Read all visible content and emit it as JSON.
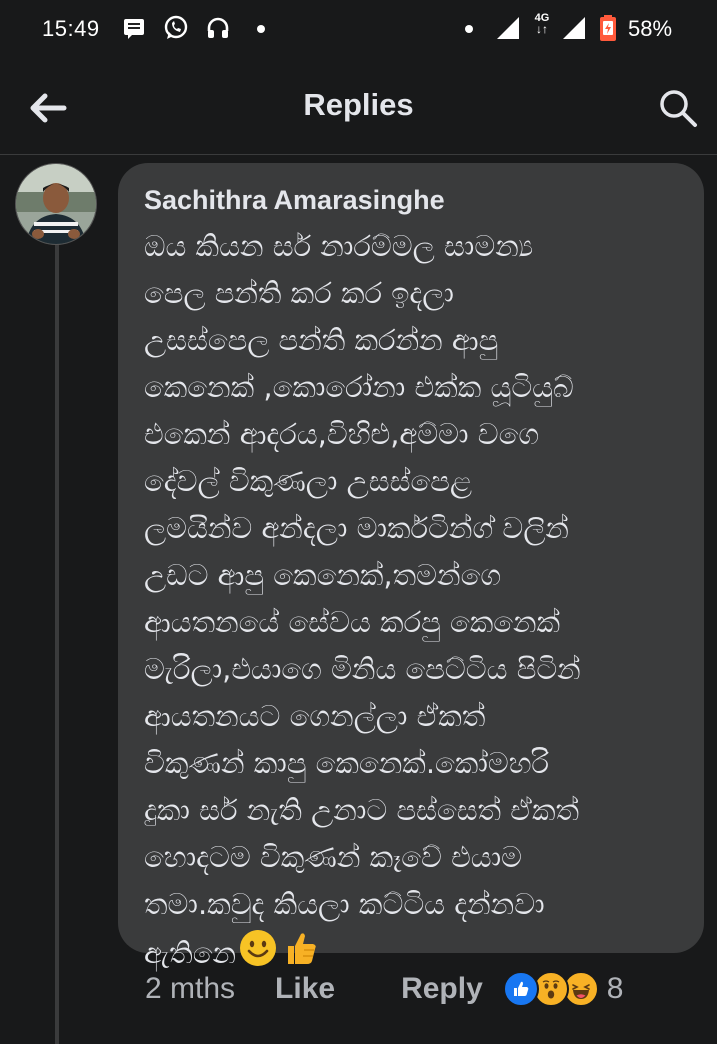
{
  "status_bar": {
    "time": "15:49",
    "battery": "58%",
    "network": "4G",
    "icons": [
      "message-icon",
      "whatsapp-icon",
      "headphones-icon",
      "wifi-icon",
      "signal-icon",
      "battery-icon"
    ]
  },
  "header": {
    "title": "Replies",
    "back_icon": "arrow-left-icon",
    "search_icon": "search-icon"
  },
  "comment": {
    "author": "Sachithra Amarasinghe",
    "text": "ඔය කියන සර් නාරම්මල සාමන්‍ය\nපෙල පන්ති කර කර ඉදලා\nඋසස්පෙල පන්ති කරන්න ආපු\nකෙනෙක් ,කොරෝනා එක්ක යූටියුබ්\nඑකෙන් ආදරය,විහිළු,අම්මා වගෙ\nදේවල්  විකුණලා උසස්පෙළ\nලමයින්ව අන්දලා මාර්කටින්ග් වලින්\nඋඩට ආපු කෙනෙක්,තමන්ගෙ\nආයතනයේ සේවය කරපු කෙනෙක්\nමැරිලා,එයාගෙ මිනිය පෙට්ටිය පිටින්\nආයතනයට ගෙනල්ලා ඒකත්\nවිකුණන් කාපු කෙනෙක්.කෝමහරි\nදුකා සර් නැති උනාට පස්සෙත් ඒකත්\nහොදටම විකුණන් කෑවේ එයාම\nතමා.කවුද කියලා කට්ටිය දන්නවා\nඇතිනෙ",
    "emojis": [
      "smiling-face-icon",
      "thumbs-up-icon"
    ]
  },
  "actions": {
    "time_ago": "2 mths",
    "like_label": "Like",
    "reply_label": "Reply",
    "reaction_icons": [
      "like-reaction-icon",
      "wow-reaction-icon",
      "haha-reaction-icon"
    ],
    "reaction_count": "8"
  },
  "colors": {
    "background": "#18191a",
    "bubble": "#3a3b3c",
    "text_primary": "#e4e6eb",
    "text_secondary": "#b0b3b8",
    "like_blue": "#1877f2",
    "reaction_yellow": "#f7b125"
  }
}
